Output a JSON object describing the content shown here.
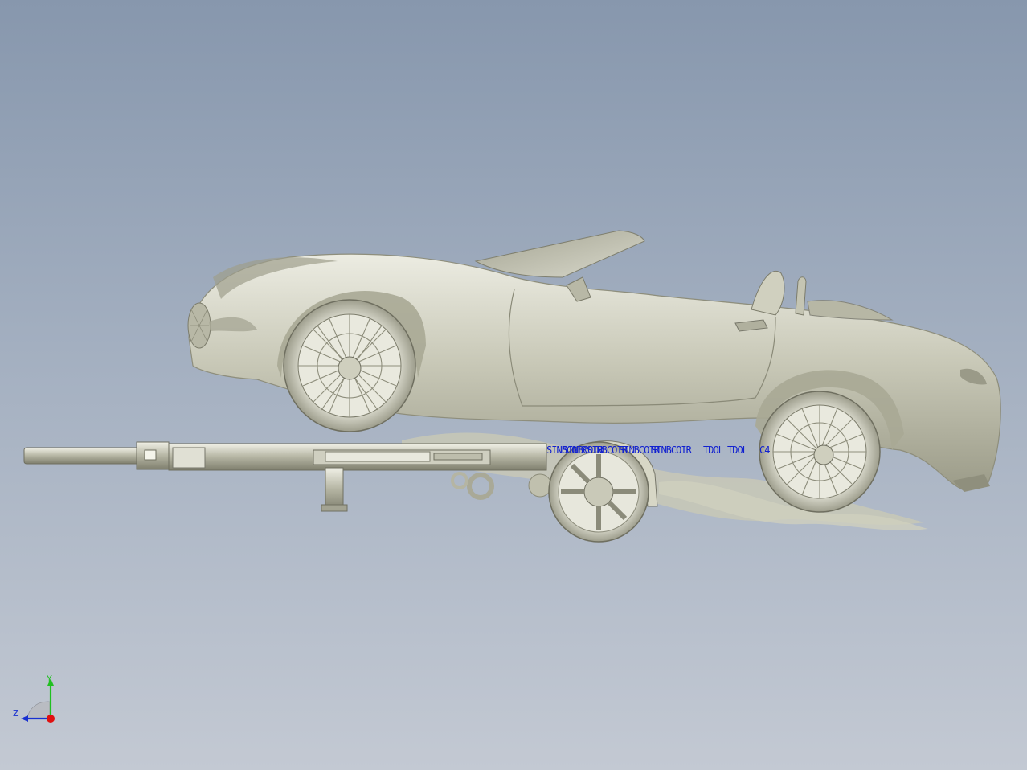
{
  "viewport": {
    "background_top": "#8797ad",
    "background_bottom": "#c3c9d3",
    "model_color": "#d6d6c6",
    "overlay_color": "#1020d0"
  },
  "overlay_labels": [
    "SINBCOIR",
    "TDOL",
    "C4"
  ],
  "triad": {
    "y_label": "Y",
    "z_label": "Z",
    "y_color": "#20c020",
    "z_color": "#1830d0",
    "origin_color": "#e01010"
  }
}
